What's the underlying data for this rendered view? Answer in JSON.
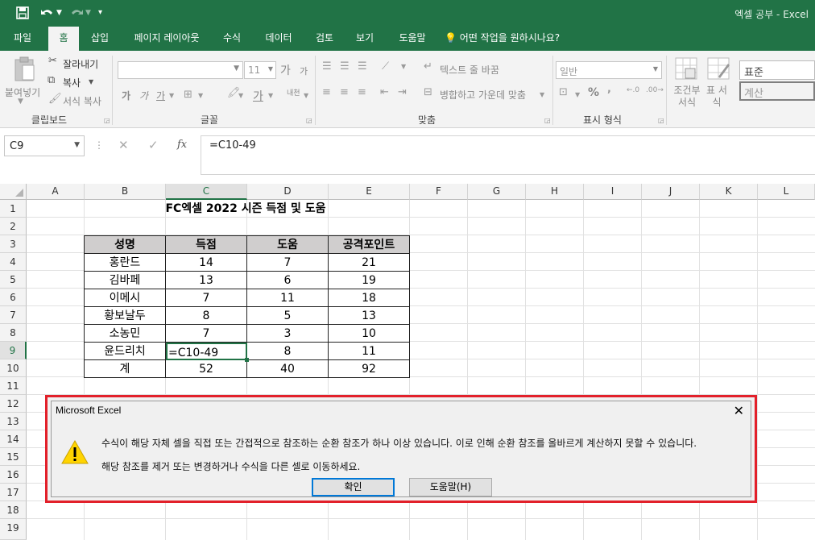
{
  "titlebar": {
    "doc_title": "엑셀 공부  -  Excel"
  },
  "tabs": [
    {
      "label": "파일"
    },
    {
      "label": "홈"
    },
    {
      "label": "삽입"
    },
    {
      "label": "페이지 레이아웃"
    },
    {
      "label": "수식"
    },
    {
      "label": "데이터"
    },
    {
      "label": "검토"
    },
    {
      "label": "보기"
    },
    {
      "label": "도움말"
    },
    {
      "label": "어떤 작업을 원하시나요?"
    }
  ],
  "ribbon": {
    "clipboard": {
      "paste": "붙여넣기",
      "cut": "잘라내기",
      "copy": "복사",
      "format_painter": "서식 복사",
      "label": "클립보드"
    },
    "font": {
      "font_size": "11",
      "label": "글꼴",
      "bold": "가",
      "italic": "가",
      "underline": "가",
      "shrink": "가",
      "grow": "가",
      "color": "가",
      "phonetic": "내천"
    },
    "alignment": {
      "wrap": "텍스트 줄 바꿈",
      "merge": "병합하고 가운데 맞춤",
      "label": "맞춤"
    },
    "number": {
      "format": "일반",
      "label": "표시 형식",
      "percent": "%"
    },
    "styles": {
      "conditional": "조건부 서식",
      "table": "표 서식",
      "normal": "표준",
      "calc": "계산"
    }
  },
  "formula_bar": {
    "name_box": "C9",
    "formula": "=C10-49",
    "fx": "fx"
  },
  "columns": [
    "A",
    "B",
    "C",
    "D",
    "E",
    "F",
    "G",
    "H",
    "I",
    "J",
    "K",
    "L"
  ],
  "rows": [
    "1",
    "2",
    "3",
    "4",
    "5",
    "6",
    "7",
    "8",
    "9",
    "10",
    "11",
    "12",
    "13",
    "14",
    "15",
    "16",
    "17",
    "18",
    "19"
  ],
  "sheet": {
    "title": "FC엑셀 2022 시즌 득점 및 도움",
    "headers": [
      "성명",
      "득점",
      "도움",
      "공격포인트"
    ],
    "data": [
      [
        "홍란드",
        "14",
        "7",
        "21"
      ],
      [
        "김바페",
        "13",
        "6",
        "19"
      ],
      [
        "이메시",
        "7",
        "11",
        "18"
      ],
      [
        "황보날두",
        "8",
        "5",
        "13"
      ],
      [
        "소농민",
        "7",
        "3",
        "10"
      ],
      [
        "윤드리치",
        "=C10-49",
        "8",
        "11"
      ],
      [
        "계",
        "52",
        "40",
        "92"
      ]
    ]
  },
  "dialog": {
    "title": "Microsoft Excel",
    "message1": "수식이 해당 자체 셀을 직접 또는 간접적으로 참조하는 순환 참조가 하나 이상 있습니다. 이로 인해 순환 참조를 올바르게 계산하지 못할 수 있습니다.",
    "message2": "해당 참조를 제거 또는 변경하거나 수식을 다른 셀로 이동하세요.",
    "ok": "확인",
    "help": "도움말(H)",
    "close": "✕",
    "warning_icon": "warning-icon"
  }
}
